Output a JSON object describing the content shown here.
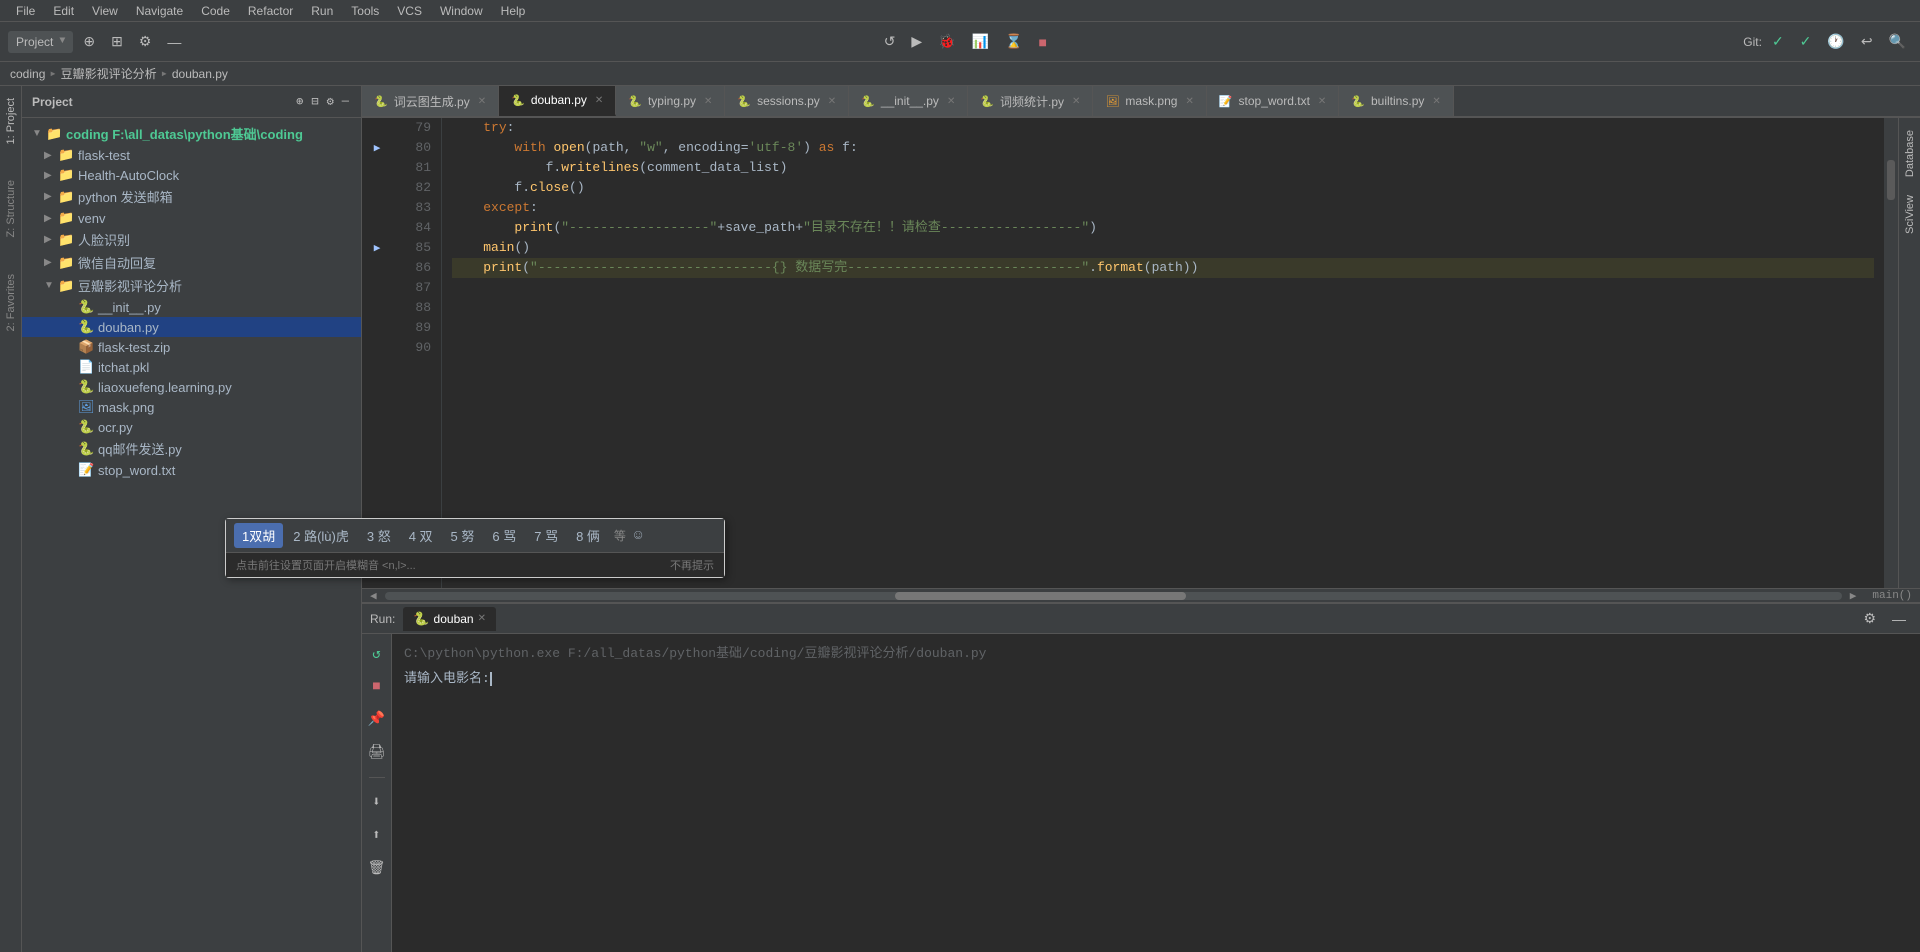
{
  "menu": {
    "items": [
      "File",
      "Edit",
      "View",
      "Navigate",
      "Code",
      "Refactor",
      "Run",
      "Tools",
      "VCS",
      "Window",
      "Help"
    ]
  },
  "toolbar": {
    "project_label": "Project",
    "git_label": "Git:",
    "breadcrumb": [
      "coding",
      "豆瓣影视评论分析",
      "douban.py"
    ],
    "separator": "▸"
  },
  "tabs": [
    {
      "label": "词云图生成.py",
      "type": "py",
      "active": false
    },
    {
      "label": "douban.py",
      "type": "py",
      "active": true
    },
    {
      "label": "typing.py",
      "type": "py",
      "active": false
    },
    {
      "label": "sessions.py",
      "type": "py",
      "active": false
    },
    {
      "label": "__init__.py",
      "type": "py",
      "active": false
    },
    {
      "label": "词频统计.py",
      "type": "py",
      "active": false
    },
    {
      "label": "mask.png",
      "type": "img",
      "active": false
    },
    {
      "label": "stop_word.txt",
      "type": "txt",
      "active": false
    },
    {
      "label": "builtins.py",
      "type": "py",
      "active": false
    }
  ],
  "sidebar": {
    "header": "Project",
    "tree": [
      {
        "level": 0,
        "name": "Project",
        "type": "root",
        "expanded": true
      },
      {
        "level": 1,
        "name": "coding  F:\\all_datas\\python基础\\coding",
        "type": "folder",
        "expanded": true
      },
      {
        "level": 2,
        "name": "flask-test",
        "type": "folder",
        "expanded": false
      },
      {
        "level": 2,
        "name": "Health-AutoClock",
        "type": "folder",
        "expanded": false
      },
      {
        "level": 2,
        "name": "python 发送邮箱",
        "type": "folder",
        "expanded": false
      },
      {
        "level": 2,
        "name": "venv",
        "type": "folder",
        "expanded": false
      },
      {
        "level": 2,
        "name": "人脸识别",
        "type": "folder",
        "expanded": false
      },
      {
        "level": 2,
        "name": "微信自动回复",
        "type": "folder",
        "expanded": false
      },
      {
        "level": 2,
        "name": "豆瓣影视评论分析",
        "type": "folder",
        "expanded": true
      },
      {
        "level": 3,
        "name": "__init__.py",
        "type": "py",
        "expanded": false
      },
      {
        "level": 3,
        "name": "douban.py",
        "type": "py",
        "expanded": false,
        "selected": true
      },
      {
        "level": 3,
        "name": "flask-test.zip",
        "type": "zip",
        "expanded": false
      },
      {
        "level": 3,
        "name": "itchat.pkl",
        "type": "file",
        "expanded": false
      },
      {
        "level": 3,
        "name": "liaoxuefeng.learning.py",
        "type": "py",
        "expanded": false
      },
      {
        "level": 3,
        "name": "mask.png",
        "type": "img",
        "expanded": false
      },
      {
        "level": 3,
        "name": "ocr.py",
        "type": "py",
        "expanded": false
      },
      {
        "level": 3,
        "name": "qq邮件发送.py",
        "type": "py",
        "expanded": false
      },
      {
        "level": 3,
        "name": "stop_word.txt",
        "type": "txt",
        "expanded": false
      }
    ]
  },
  "code": {
    "lines": [
      {
        "num": 79,
        "content": "    try:",
        "highlighted": false
      },
      {
        "num": 80,
        "content": "        with open(path, \"w\", encoding='utf-8') as f:",
        "highlighted": false
      },
      {
        "num": 81,
        "content": "            f.writelines(comment_data_list)",
        "highlighted": false
      },
      {
        "num": 82,
        "content": "        f.close()",
        "highlighted": false
      },
      {
        "num": 83,
        "content": "    except:",
        "highlighted": false
      },
      {
        "num": 84,
        "content": "        print(\"------------------\"+save_path+\"目录不存在！！请检查------------------\")",
        "highlighted": false
      },
      {
        "num": 85,
        "content": "    main()",
        "highlighted": false
      },
      {
        "num": 86,
        "content": "    print(\"------------------------------{} 数据写完------------------------------\".format(path))",
        "highlighted": true
      },
      {
        "num": 87,
        "content": "",
        "highlighted": false
      },
      {
        "num": 88,
        "content": "",
        "highlighted": false
      },
      {
        "num": 89,
        "content": "",
        "highlighted": false
      },
      {
        "num": 90,
        "content": "",
        "highlighted": false
      }
    ],
    "scroll_indicator": "main()"
  },
  "run_panel": {
    "label": "Run:",
    "tab_label": "douban",
    "command": "C:\\python\\python.exe F:/all_datas/python基础/coding/豆瓣影视评论分析/douban.py",
    "prompt": "请输入电影名:"
  },
  "ime": {
    "candidates": [
      {
        "num": "1",
        "text": "双胡",
        "selected": true
      },
      {
        "num": "2",
        "text": "路(lù)虎",
        "selected": false
      },
      {
        "num": "3",
        "text": "怒",
        "selected": false
      },
      {
        "num": "4",
        "text": "双",
        "selected": false
      },
      {
        "num": "5",
        "text": "努",
        "selected": false
      },
      {
        "num": "6",
        "text": "骂",
        "selected": false
      },
      {
        "num": "7",
        "text": "骂",
        "selected": false
      },
      {
        "num": "8",
        "text": "俩",
        "selected": false
      }
    ],
    "more": "等",
    "emoji": "☺",
    "hint": "点击前往设置页面开启模糊音 <n,l>...",
    "dismiss": "不再提示"
  }
}
